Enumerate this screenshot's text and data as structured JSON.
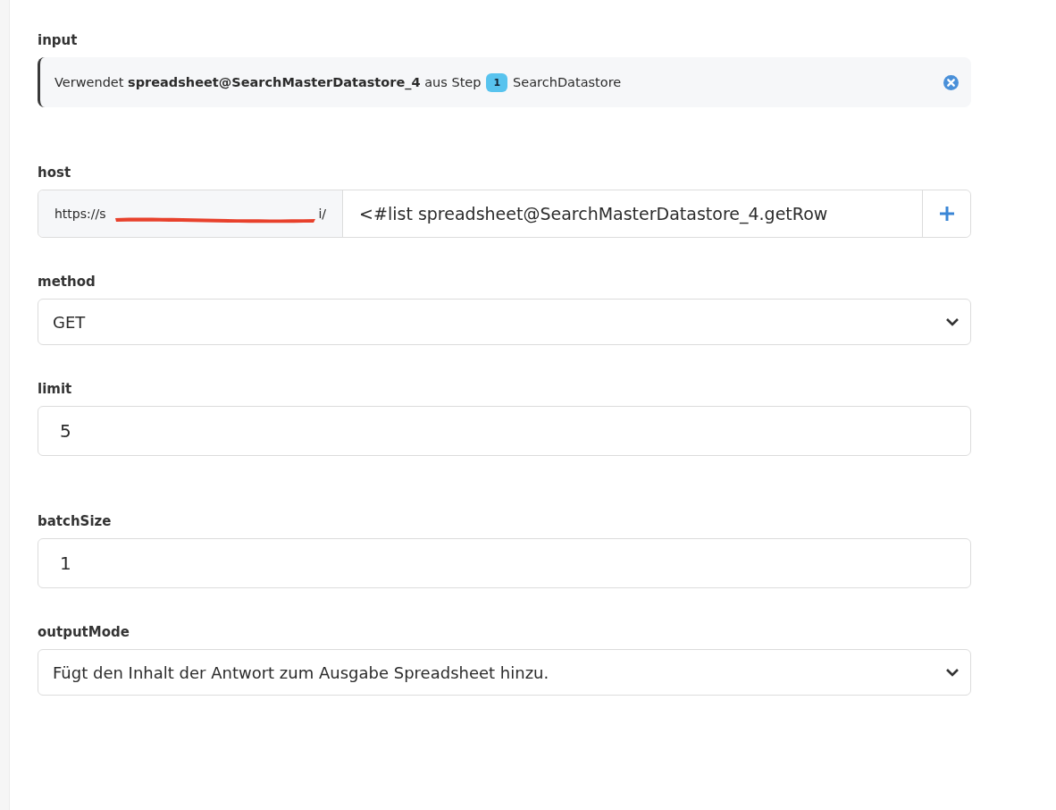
{
  "fields": [
    {
      "kind": "reference",
      "label": "input",
      "text": "Verwendet **spreadsheet@SearchMasterDatastore_4** aus Step",
      "step": "1",
      "step_name": "SearchDatastore"
    },
    {
      "kind": "prefixed",
      "label": "host",
      "prefix_start": "https://s",
      "prefix_end": "i/",
      "value": "<#list spreadsheet@SearchMasterDatastore_4.getRow"
    },
    {
      "kind": "select",
      "label": "method",
      "value": "GET"
    },
    {
      "kind": "text",
      "label": "limit",
      "value": "5"
    },
    {
      "kind": "text",
      "label": "batchSize",
      "value": "1"
    },
    {
      "kind": "select",
      "label": "outputMode",
      "value": "Fügt den Inhalt der Antwort zum Ausgabe Spreadsheet hinzu."
    }
  ]
}
